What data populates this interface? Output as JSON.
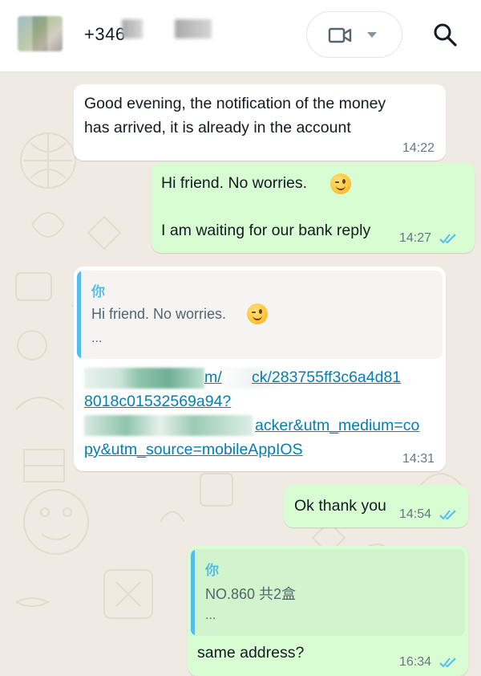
{
  "header": {
    "contact_number": "+346",
    "icons": {
      "video": "video-camera-icon",
      "dropdown": "chevron-down-icon",
      "search": "search-icon"
    }
  },
  "messages": [
    {
      "direction": "incoming",
      "lines": [
        "Good evening, the notification of the money",
        "has arrived, it is already in the account"
      ],
      "time": "14:22"
    },
    {
      "direction": "outgoing",
      "lines": [
        "Hi friend. No worries.",
        "",
        "I am waiting for our bank reply"
      ],
      "emoji": "winking-face",
      "time": "14:27",
      "status": "read"
    },
    {
      "direction": "incoming",
      "quote": {
        "author": "你",
        "text": "Hi friend. No worries.",
        "more": "..."
      },
      "link_lines": [
        "m/",
        "ck/283755ff3c6a4d81",
        "8018c01532569a94?",
        "acker&utm_medium=co",
        "py&utm_source=mobileAppIOS"
      ],
      "time": "14:31"
    },
    {
      "direction": "outgoing",
      "lines": [
        "Ok thank you"
      ],
      "time": "14:54",
      "status": "read"
    },
    {
      "direction": "outgoing",
      "quote": {
        "author": "你",
        "text": "NO.860   共2盒",
        "more": "..."
      },
      "lines": [
        "same address?"
      ],
      "time": "16:34",
      "status": "read"
    }
  ],
  "colors": {
    "incoming": "#ffffff",
    "outgoing": "#d9fdd3",
    "read_ticks": "#53bdeb",
    "link": "#027eb5",
    "background": "#efeae2"
  }
}
